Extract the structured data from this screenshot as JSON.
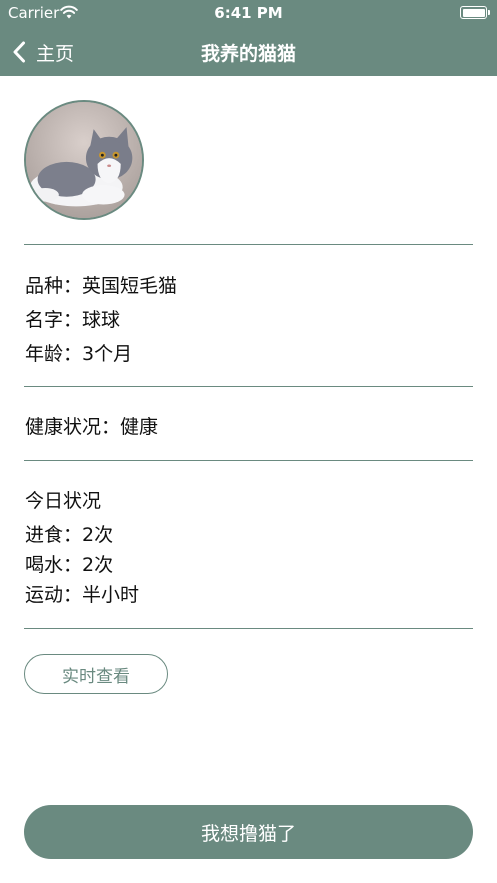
{
  "status_bar": {
    "carrier": "Carrier",
    "time": "6:41 PM",
    "wifi_icon": "wifi-icon",
    "battery_icon": "battery-icon"
  },
  "nav": {
    "back_icon": "chevron-left-icon",
    "back_label": "主页",
    "title": "我养的猫猫"
  },
  "profile": {
    "breed_label": "品种：",
    "breed_value": "英国短毛猫",
    "name_label": "名字：",
    "name_value": "球球",
    "age_label": "年龄：",
    "age_value": "3个月"
  },
  "health": {
    "label": "健康状况：",
    "value": "健康"
  },
  "today": {
    "title": "今日状况",
    "eating_label": "进食：",
    "eating_value": "2次",
    "drinking_label": "喝水：",
    "drinking_value": "2次",
    "exercise_label": "运动：",
    "exercise_value": "半小时"
  },
  "buttons": {
    "realtime_view": "实时查看",
    "pet_cat": "我想撸猫了"
  },
  "colors": {
    "accent": "#6a8a80",
    "background": "#ffffff",
    "text": "#111111"
  }
}
